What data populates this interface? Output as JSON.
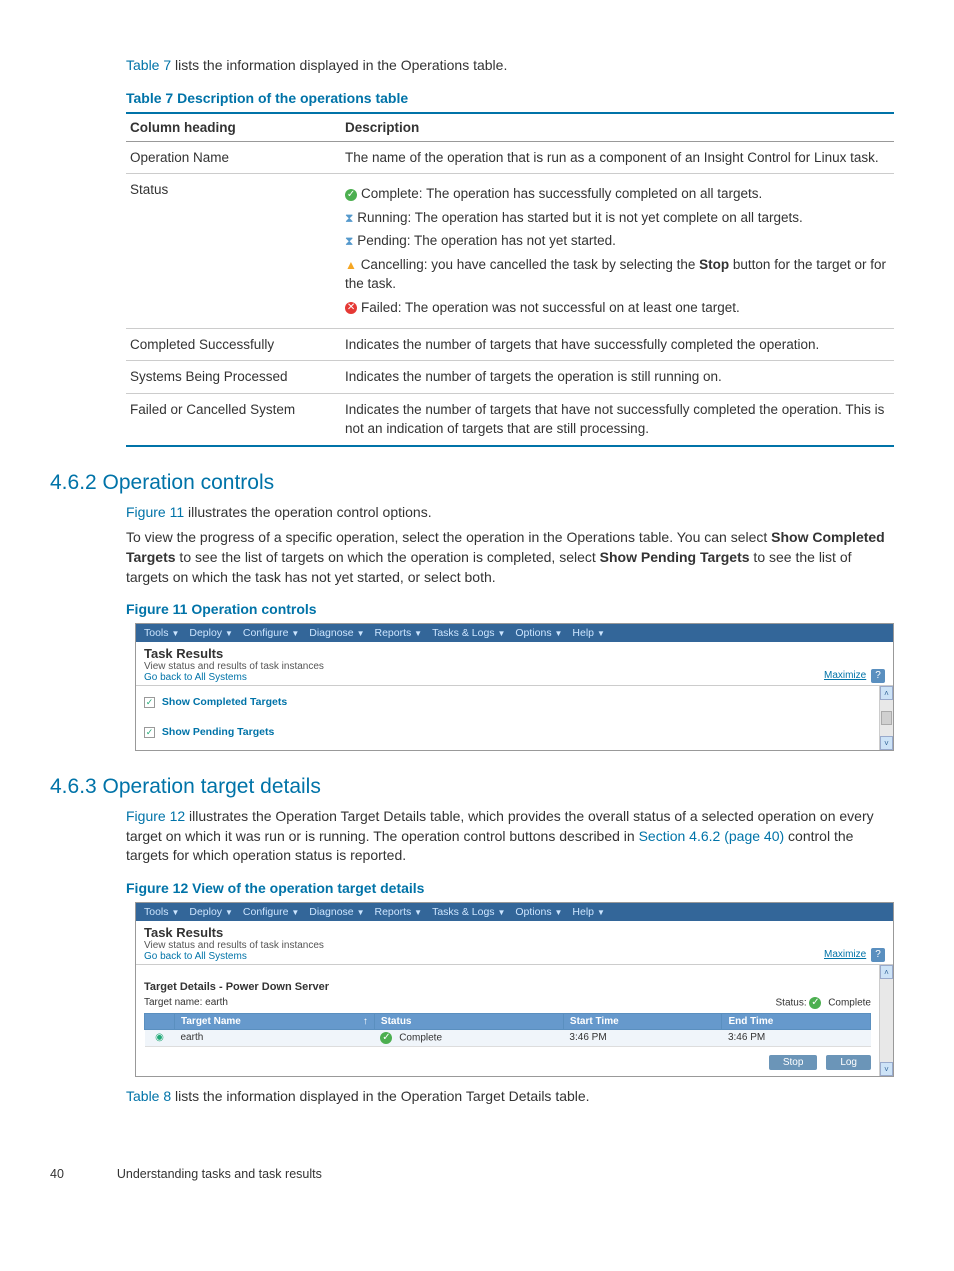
{
  "intro": {
    "link": "Table 7",
    "rest": " lists the information displayed in the Operations table."
  },
  "table7": {
    "caption": "Table 7 Description of the operations table",
    "head1": "Column heading",
    "head2": "Description",
    "rows": [
      {
        "col": "Operation Name",
        "desc": "The name of the operation that is run as a component of an Insight Control for Linux task."
      },
      {
        "col": "Status",
        "desc": ""
      },
      {
        "col": "Completed Successfully",
        "desc": "Indicates the number of targets that have successfully completed the operation."
      },
      {
        "col": "Systems Being Processed",
        "desc": "Indicates the number of targets the operation is still running on."
      },
      {
        "col": "Failed or Cancelled System",
        "desc": "Indicates the number of targets that have not successfully completed the operation. This is not an indication of targets that are still processing."
      }
    ],
    "status": {
      "complete": "Complete: The operation has successfully completed on all targets.",
      "running": "Running: The operation has started but it is not yet complete on all targets.",
      "pending": "Pending: The operation has not yet started.",
      "cancel_pre": "Cancelling: you have cancelled the task by selecting the ",
      "cancel_bold": "Stop",
      "cancel_post": " button for the target or for the task.",
      "failed": "Failed: The operation was not successful on at least one target."
    }
  },
  "sec462": {
    "heading": "4.6.2 Operation controls",
    "p1_link": "Figure 11",
    "p1_rest": " illustrates the operation control options.",
    "p2a": "To view the progress of a specific operation, select the operation in the Operations table. You can select ",
    "p2b": "Show Completed Targets",
    "p2c": " to see the list of targets on which the operation is completed, select ",
    "p2d": "Show Pending Targets",
    "p2e": " to see the list of targets on which the task has not yet started, or select both.",
    "fig_caption": "Figure 11 Operation controls"
  },
  "menus": [
    "Tools",
    "Deploy",
    "Configure",
    "Diagnose",
    "Reports",
    "Tasks & Logs",
    "Options",
    "Help"
  ],
  "task_results": {
    "title": "Task Results",
    "sub": "View status and results of task instances",
    "goback_pre": "Go back to ",
    "goback_link": "All Systems",
    "maximize": "Maximize",
    "q": "?"
  },
  "fig11": {
    "chk1": "Show Completed Targets",
    "chk2": "Show Pending Targets"
  },
  "sec463": {
    "heading": "4.6.3 Operation target details",
    "p1_link": "Figure 12",
    "p1a": " illustrates the Operation Target Details table, which provides the overall status of a selected operation on every target on which it was run or is running. The operation control buttons described in ",
    "p1_link2": "Section 4.6.2 (page 40)",
    "p1b": " control the targets for which operation status is reported.",
    "fig_caption": "Figure 12 View of the operation target details"
  },
  "fig12": {
    "detail_title": "Target Details - Power Down Server",
    "target_name_label": "Target name: earth",
    "status_label": "Status: ",
    "status_val": "Complete",
    "cols": [
      "Target Name",
      "Status",
      "Start Time",
      "End Time"
    ],
    "row": {
      "name": "earth",
      "status": "Complete",
      "start": "3:46 PM",
      "end": "3:46 PM"
    },
    "btn_stop": "Stop",
    "btn_log": "Log"
  },
  "outro": {
    "link": "Table 8",
    "rest": " lists the information displayed in the Operation Target Details table."
  },
  "footer": {
    "page": "40",
    "chapter": "Understanding tasks and task results"
  }
}
